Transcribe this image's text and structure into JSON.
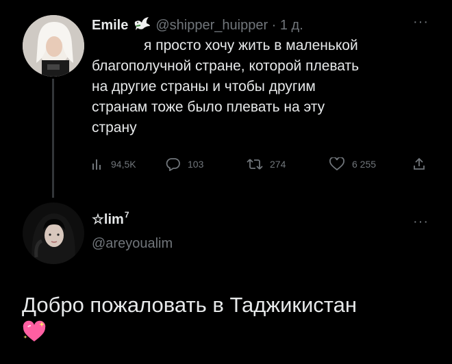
{
  "tweet": {
    "author_name": "Emile",
    "author_badge_icon": "dove-icon",
    "handle_time": "@shipper_huipper · 1 д.",
    "lines": [
      "я просто хочу жить в маленькой",
      "благополучной стране, которой плевать",
      "на другие страны и чтобы другим",
      "странам тоже было плевать на эту",
      "страну"
    ],
    "stats": {
      "views": "94,5K",
      "replies": "103",
      "retweets": "274",
      "likes": "6 255"
    }
  },
  "reply": {
    "author_name": "☆lim",
    "author_superscript": "7",
    "handle": "@areyoualim",
    "text": "Добро пожаловать в Таджикистан",
    "emoji": "sparkling-heart-icon"
  },
  "colors": {
    "background": "#000000",
    "text": "#e7e9ea",
    "muted": "#71767b",
    "heart": "#ff5fa2"
  }
}
